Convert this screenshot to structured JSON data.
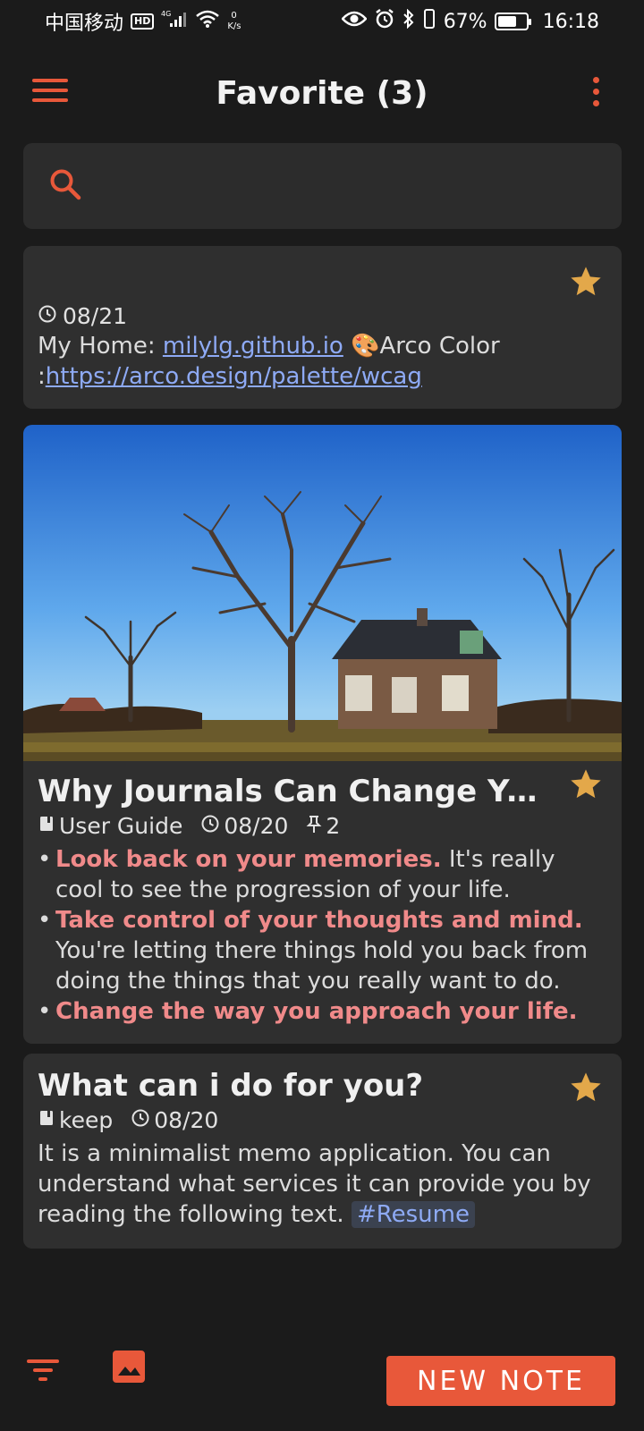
{
  "status_bar": {
    "carrier": "中国移动",
    "hd": "HD",
    "network_type": "4G",
    "net_speed_value": "0",
    "net_speed_unit": "K/s",
    "battery": "67%",
    "battery_level": 0.67,
    "time": "16:18"
  },
  "app_bar": {
    "title": "Favorite (3)"
  },
  "search": {
    "placeholder": ""
  },
  "notes": [
    {
      "date": "08/21",
      "text_prefix": "My Home: ",
      "link1": "milylg.github.io",
      "emoji": "🎨",
      "text_mid": "Arco Color :",
      "link2": "https://arco.design/palette/wcag"
    },
    {
      "title": "Why Journals Can Change Your...",
      "category": "User Guide",
      "date": "08/20",
      "pins": "2",
      "bullets": [
        {
          "highlight": "Look back on your memories.",
          "rest": " It's really cool to see the progression of your life."
        },
        {
          "highlight": "Take control of your thoughts and mind.",
          "rest": " You're letting there things hold you back from doing the things that you really want to do."
        },
        {
          "highlight": "Change the way you approach your life.",
          "rest": ""
        }
      ]
    },
    {
      "title": "What can i do for you?",
      "category": "keep",
      "date": "08/20",
      "text": "It is a minimalist memo application. You can understand what services it can provide you by reading the following text. ",
      "tag": "#Resume"
    }
  ],
  "bottom_bar": {
    "new_note_label": "NEW NOTE"
  },
  "colors": {
    "accent": "#e8583a",
    "star": "#e3a84a",
    "link": "#8eaaf5",
    "highlight": "#f08a8a",
    "background": "#1b1b1b",
    "card": "#2f2f2f"
  },
  "icons": {
    "menu": "hamburger-icon",
    "more": "more-vert-icon",
    "search": "search-icon",
    "star": "star-icon",
    "clock": "clock-icon",
    "book": "book-icon",
    "pin": "pin-icon",
    "filter": "filter-icon",
    "image": "image-icon"
  }
}
